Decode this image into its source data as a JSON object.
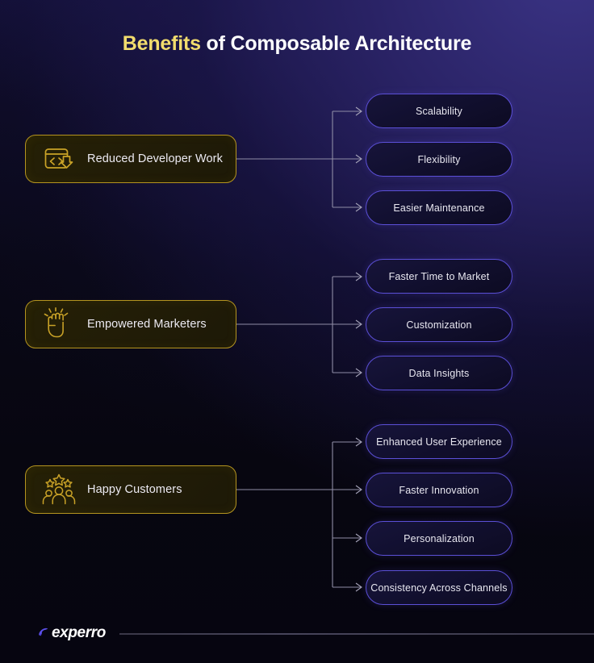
{
  "title": {
    "accent": "Benefits",
    "rest": " of Composable Architecture"
  },
  "colors": {
    "accent_gold": "#f2dc6d",
    "box_border_gold": "#b4941f",
    "pill_border_indigo": "#5b4fd6",
    "background_dark": "#07060f",
    "connector_gray": "#8f8da6"
  },
  "groups": [
    {
      "label": "Reduced Developer Work",
      "icon": "code-window-download-icon",
      "benefits": [
        "Scalability",
        "Flexibility",
        "Easier Maintenance"
      ]
    },
    {
      "label": "Empowered Marketers",
      "icon": "raised-fist-icon",
      "benefits": [
        "Faster Time to Market",
        "Customization",
        "Data Insights"
      ]
    },
    {
      "label": "Happy Customers",
      "icon": "people-with-stars-icon",
      "benefits": [
        "Enhanced User Experience",
        "Faster Innovation",
        "Personalization",
        "Consistency Across Channels"
      ]
    }
  ],
  "footer": {
    "brand": "experro",
    "logo_icon": "experro-logo-mark"
  }
}
